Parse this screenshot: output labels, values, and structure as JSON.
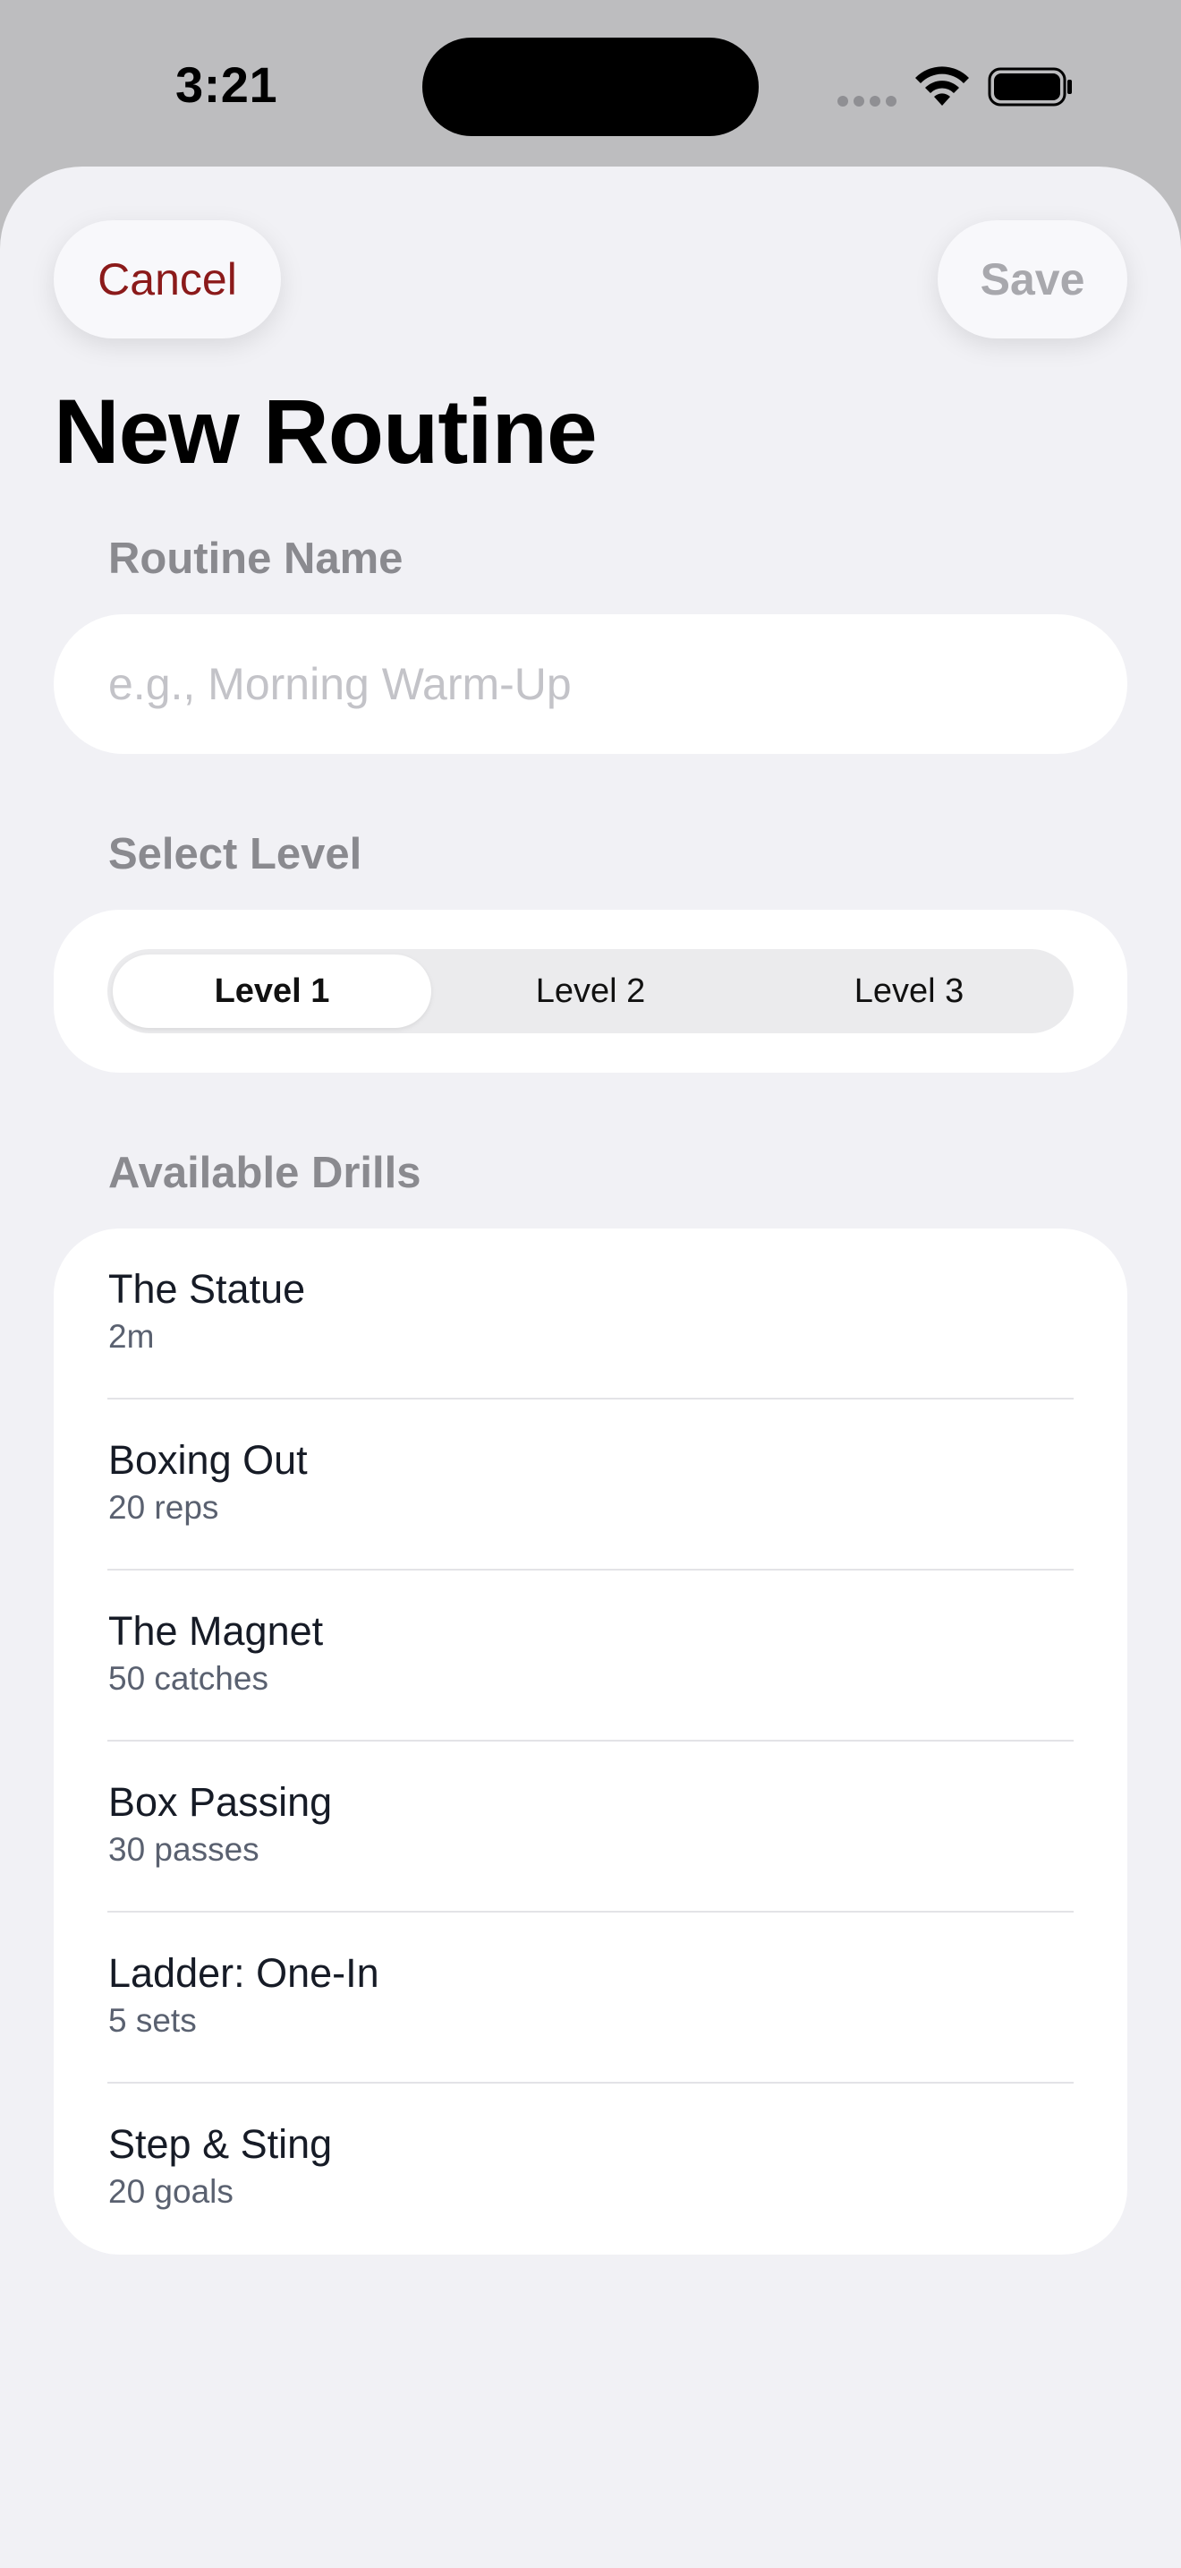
{
  "status_bar": {
    "time": "3:21"
  },
  "header": {
    "cancel_label": "Cancel",
    "save_label": "Save",
    "title": "New Routine"
  },
  "routine_name": {
    "label": "Routine Name",
    "value": "",
    "placeholder": "e.g., Morning Warm-Up"
  },
  "level": {
    "label": "Select Level",
    "options": [
      "Level 1",
      "Level 2",
      "Level 3"
    ],
    "selected": "Level 1"
  },
  "drills": {
    "label": "Available Drills",
    "items": [
      {
        "name": "The Statue",
        "meta": "2m"
      },
      {
        "name": "Boxing Out",
        "meta": "20 reps"
      },
      {
        "name": "The Magnet",
        "meta": "50 catches"
      },
      {
        "name": "Box Passing",
        "meta": "30 passes"
      },
      {
        "name": "Ladder: One-In",
        "meta": "5 sets"
      },
      {
        "name": "Step & Sting",
        "meta": "20 goals"
      }
    ]
  },
  "colors": {
    "cancel": "#8b1a1a",
    "save_disabled": "#a8a8ad",
    "sheet_background": "#f1f1f5",
    "section_label": "#8a8a8f"
  }
}
